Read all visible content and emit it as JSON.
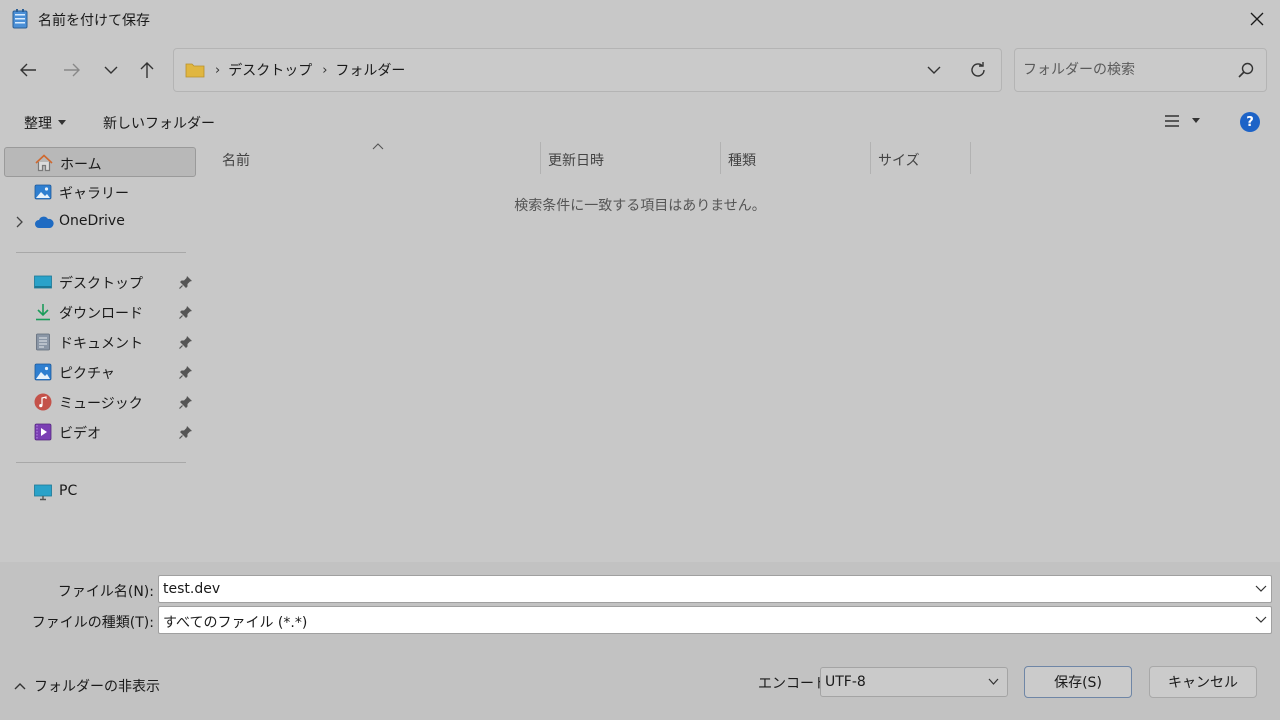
{
  "window": {
    "title": "名前を付けて保存",
    "close_icon": "close-icon"
  },
  "nav": {
    "back_icon": "arrow-left-icon",
    "forward_icon": "arrow-right-icon",
    "recent_icon": "chevron-down-icon",
    "up_icon": "arrow-up-icon"
  },
  "address": {
    "crumbs": [
      "デスクトップ",
      "フォルダー"
    ]
  },
  "search": {
    "placeholder": "フォルダーの検索"
  },
  "toolbar": {
    "organize_label": "整理",
    "new_folder_label": "新しいフォルダー",
    "help_label": "?"
  },
  "sidebar": {
    "items": [
      {
        "label": "ホーム",
        "icon": "home-icon",
        "selected": true
      },
      {
        "label": "ギャラリー",
        "icon": "gallery-icon"
      },
      {
        "label": "OneDrive",
        "icon": "cloud-icon"
      },
      {
        "label": "デスクトップ",
        "icon": "desktop-icon",
        "pinned": true
      },
      {
        "label": "ダウンロード",
        "icon": "download-icon",
        "pinned": true
      },
      {
        "label": "ドキュメント",
        "icon": "document-icon",
        "pinned": true
      },
      {
        "label": "ピクチャ",
        "icon": "picture-icon",
        "pinned": true
      },
      {
        "label": "ミュージック",
        "icon": "music-icon",
        "pinned": true
      },
      {
        "label": "ビデオ",
        "icon": "video-icon",
        "pinned": true
      },
      {
        "label": "PC",
        "icon": "pc-icon"
      }
    ]
  },
  "filelist": {
    "columns": [
      "名前",
      "更新日時",
      "種類",
      "サイズ"
    ],
    "empty_message": "検索条件に一致する項目はありません。"
  },
  "form": {
    "filename_label": "ファイル名(N):",
    "filename_value": "test.dev",
    "filetype_label": "ファイルの種類(T):",
    "filetype_value": "すべてのファイル (*.*)",
    "encoding_label": "エンコード:",
    "encoding_value": "UTF-8",
    "hide_folders_label": "フォルダーの非表示",
    "save_label": "保存(S)",
    "cancel_label": "キャンセル"
  },
  "colors": {
    "dialog_bg": "#c8c8c8",
    "accent": "#1d63c7",
    "folder": "#e0b640"
  }
}
